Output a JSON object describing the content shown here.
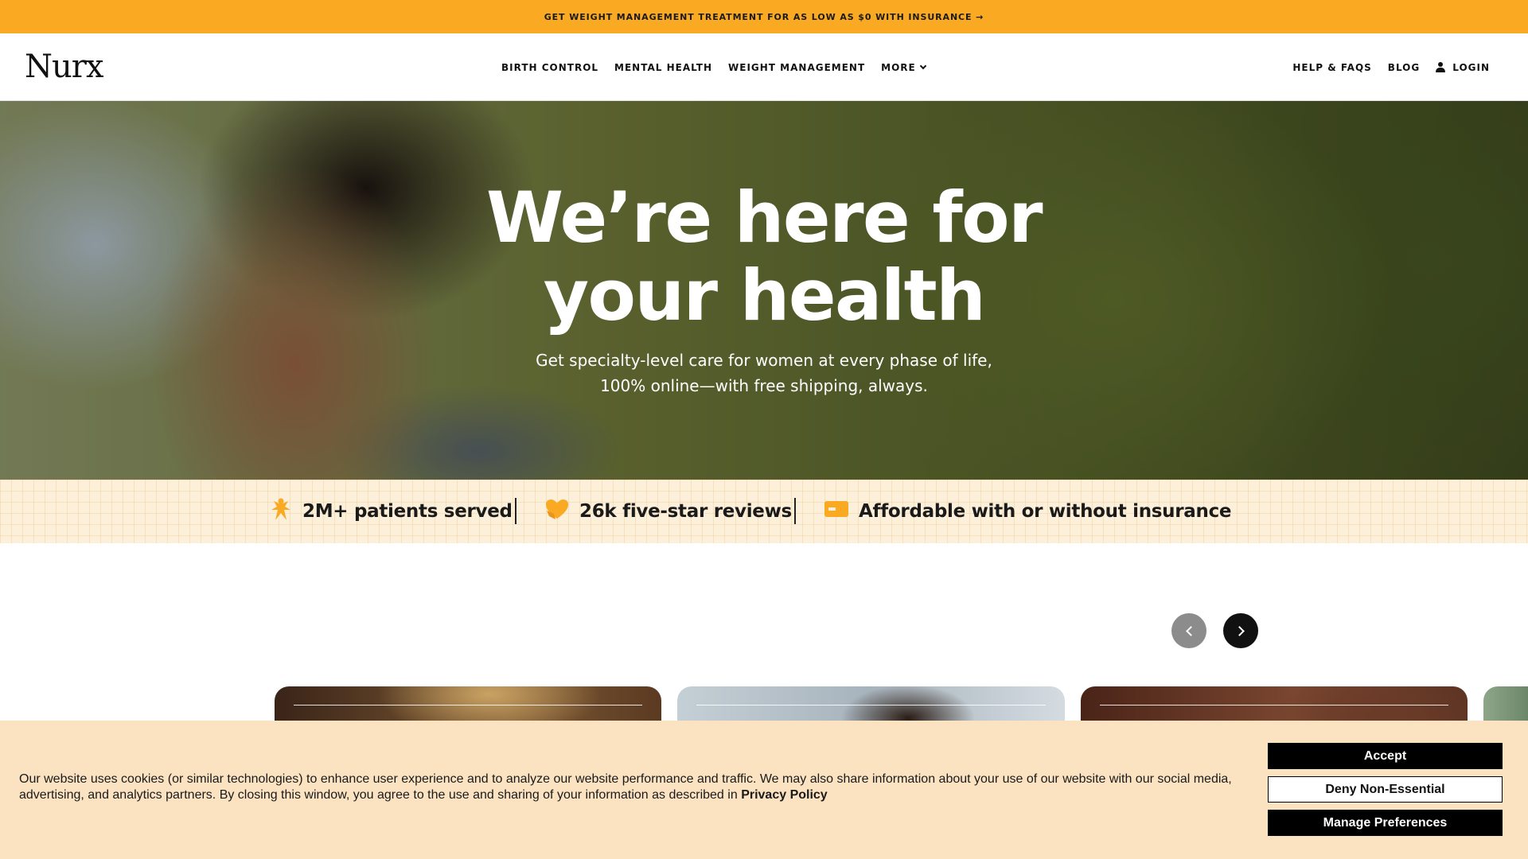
{
  "promo": {
    "text": "GET WEIGHT MANAGEMENT TREATMENT FOR AS LOW AS $0 WITH INSURANCE →"
  },
  "header": {
    "logo": "Nurx",
    "nav": [
      "BIRTH CONTROL",
      "MENTAL HEALTH",
      "WEIGHT MANAGEMENT",
      "MORE"
    ],
    "right": {
      "help": "HELP & FAQS",
      "blog": "BLOG",
      "login": "LOGIN"
    }
  },
  "hero": {
    "title_line1": "We’re here for",
    "title_line2": "your health",
    "subtitle_line1": "Get specialty-level care for women at every phase of life,",
    "subtitle_line2": "100% online—with free shipping, always."
  },
  "stats": [
    {
      "icon": "person-star-icon",
      "label": "2M+ patients served"
    },
    {
      "icon": "heart-hand-icon",
      "label": "26k five-star reviews"
    },
    {
      "icon": "card-icon",
      "label": "Affordable with or without insurance"
    }
  ],
  "cookie": {
    "text": "Our website uses cookies (or similar technologies) to enhance user experience and to analyze our website performance and traffic. We may also share information about your use of our website with our social media, advertising, and analytics partners. By closing this window, you agree to the use and sharing of your information as described in",
    "link": "Privacy Policy",
    "accept": "Accept",
    "deny": "Deny Non-Essential",
    "manage": "Manage Preferences"
  },
  "colors": {
    "accent": "#f9a922",
    "stats_bg": "#fdf0da",
    "cookie_bg": "#fbe3c2"
  }
}
